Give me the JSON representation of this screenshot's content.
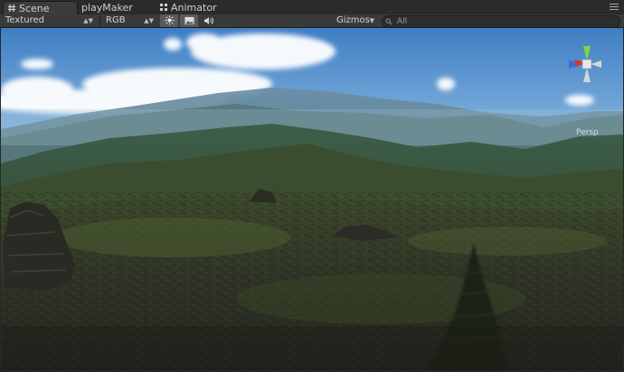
{
  "tabs": [
    {
      "label": "Scene",
      "icon": "hash-icon",
      "active": true
    },
    {
      "label": "playMaker",
      "icon": "",
      "active": false
    },
    {
      "label": "Animator",
      "icon": "animator-grid-icon",
      "active": false
    }
  ],
  "toolbar": {
    "render_mode": "Textured",
    "color_mode": "RGB",
    "lighting_icon": "sun-icon",
    "image_icon": "image-icon",
    "audio_icon": "speaker-icon",
    "gizmos_label": "Gizmos",
    "search_value": "All",
    "search_icon": "search-icon"
  },
  "viewport": {
    "persp_label": "Persp",
    "gizmo": "scene-orientation-gizmo"
  },
  "colors": {
    "tab_bar": "#2b2b2b",
    "toolbar": "#3a3a3a",
    "sky_top": "#3f7ec4",
    "sky_horizon": "#b9d7ec",
    "terrain_dark": "#2f3326",
    "gizmo_x": "#d23a2a",
    "gizmo_y": "#7fd83a",
    "gizmo_z": "#3b6cd8"
  }
}
